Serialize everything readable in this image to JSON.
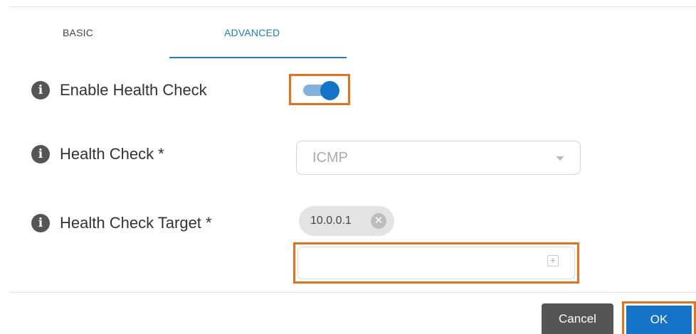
{
  "tabs": {
    "basic_label": "BASIC",
    "advanced_label": "ADVANCED",
    "active": "ADVANCED"
  },
  "health_check_enable": {
    "label": "Enable Health Check",
    "enabled": true
  },
  "health_check": {
    "label": "Health Check *",
    "selected": "ICMP"
  },
  "health_check_target": {
    "label": "Health Check Target *",
    "chips": [
      "10.0.0.1"
    ],
    "input_value": ""
  },
  "footer": {
    "cancel_label": "Cancel",
    "ok_label": "OK"
  },
  "icons": {
    "info": "i",
    "chip_remove": "✕",
    "add": "+"
  },
  "colors": {
    "accent": "#1473c7",
    "highlight": "#e8701a",
    "cancel_bg": "#555555"
  }
}
